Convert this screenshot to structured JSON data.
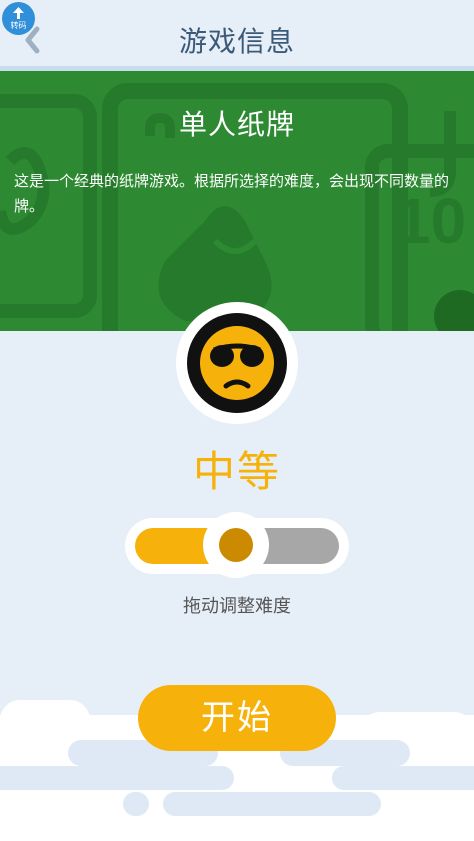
{
  "header": {
    "badge_text": "转码",
    "title": "游戏信息"
  },
  "game": {
    "name": "单人纸牌",
    "description": "这是一个经典的纸牌游戏。根据所选择的难度，会出现不同数量的牌。",
    "banner_card_glyph": "10"
  },
  "difficulty": {
    "label": "中等",
    "level_fraction": 0.45,
    "hint": "拖动调整难度"
  },
  "start_button": {
    "label": "开始"
  },
  "colors": {
    "banner_green": "#2d8a33",
    "accent_orange": "#f7b10b",
    "title_blue": "#3c5a78",
    "background": "#e6eff8"
  },
  "icons": {
    "back": "chevron-left-icon",
    "badge": "leaf-icon",
    "level": "cool-face-icon"
  }
}
